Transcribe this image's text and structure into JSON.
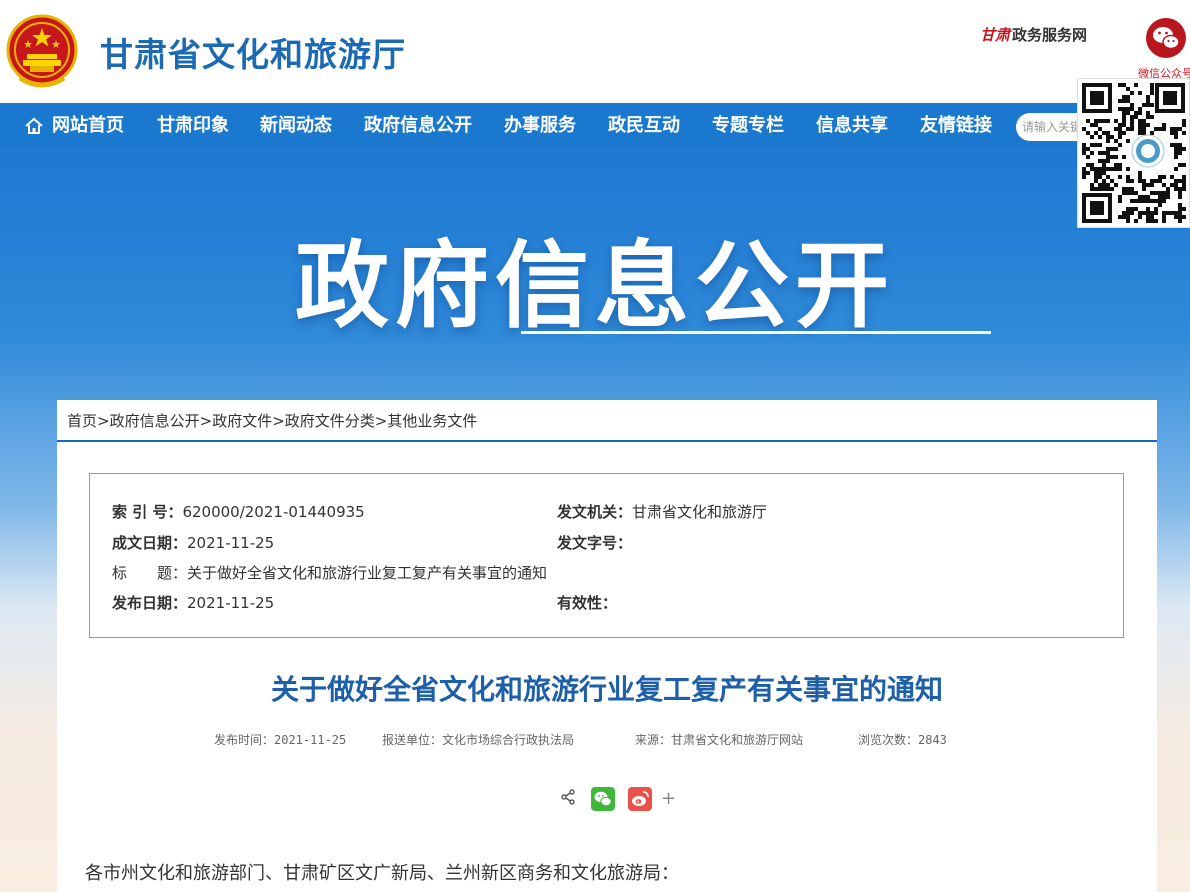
{
  "header": {
    "site_title": "甘肃省文化和旅游厅",
    "gov_service_brand": "甘肃",
    "gov_service_text": "政务服务网",
    "wechat_label": "微信公众号"
  },
  "nav": {
    "items": [
      "网站首页",
      "甘肃印象",
      "新闻动态",
      "政府信息公开",
      "办事服务",
      "政民互动",
      "专题专栏",
      "信息共享",
      "友情链接"
    ],
    "search_placeholder": "请输入关键"
  },
  "banner": {
    "title": "政府信息公开"
  },
  "breadcrumb": {
    "items": [
      "首页",
      "政府信息公开",
      "政府文件",
      "政府文件分类",
      "其他业务文件"
    ],
    "separator": ">"
  },
  "metadata": {
    "index_label": "索 引 号：",
    "index_value": "620000/2021-01440935",
    "issuer_label": "发文机关：",
    "issuer_value": "甘肃省文化和旅游厅",
    "date_label": "成文日期：",
    "date_value": "2021-11-25",
    "doc_no_label": "发文字号：",
    "doc_no_value": "",
    "title_label": "标　　题：",
    "title_value": "关于做好全省文化和旅游行业复工复产有关事宜的通知",
    "pub_label": "发布日期：",
    "pub_value": "2021-11-25",
    "validity_label": "有效性：",
    "validity_value": ""
  },
  "article": {
    "title": "关于做好全省文化和旅游行业复工复产有关事宜的通知",
    "publish_time": "发布时间：2021-11-25",
    "submitter": "报送单位：文化市场综合行政执法局",
    "source": "来源：甘肃省文化和旅游厅网站",
    "views": "浏览次数：2843",
    "more_share": "+",
    "salutation": "各市州文化和旅游部门、甘肃矿区文广新局、兰州新区商务和文化旅游局："
  },
  "colors": {
    "brand_blue": "#1c6ab3",
    "nav_blue": "#1a78cf",
    "emblem_red": "#c8161d",
    "wechat_green": "#3fb73a",
    "weibo_red": "#e9524a"
  }
}
